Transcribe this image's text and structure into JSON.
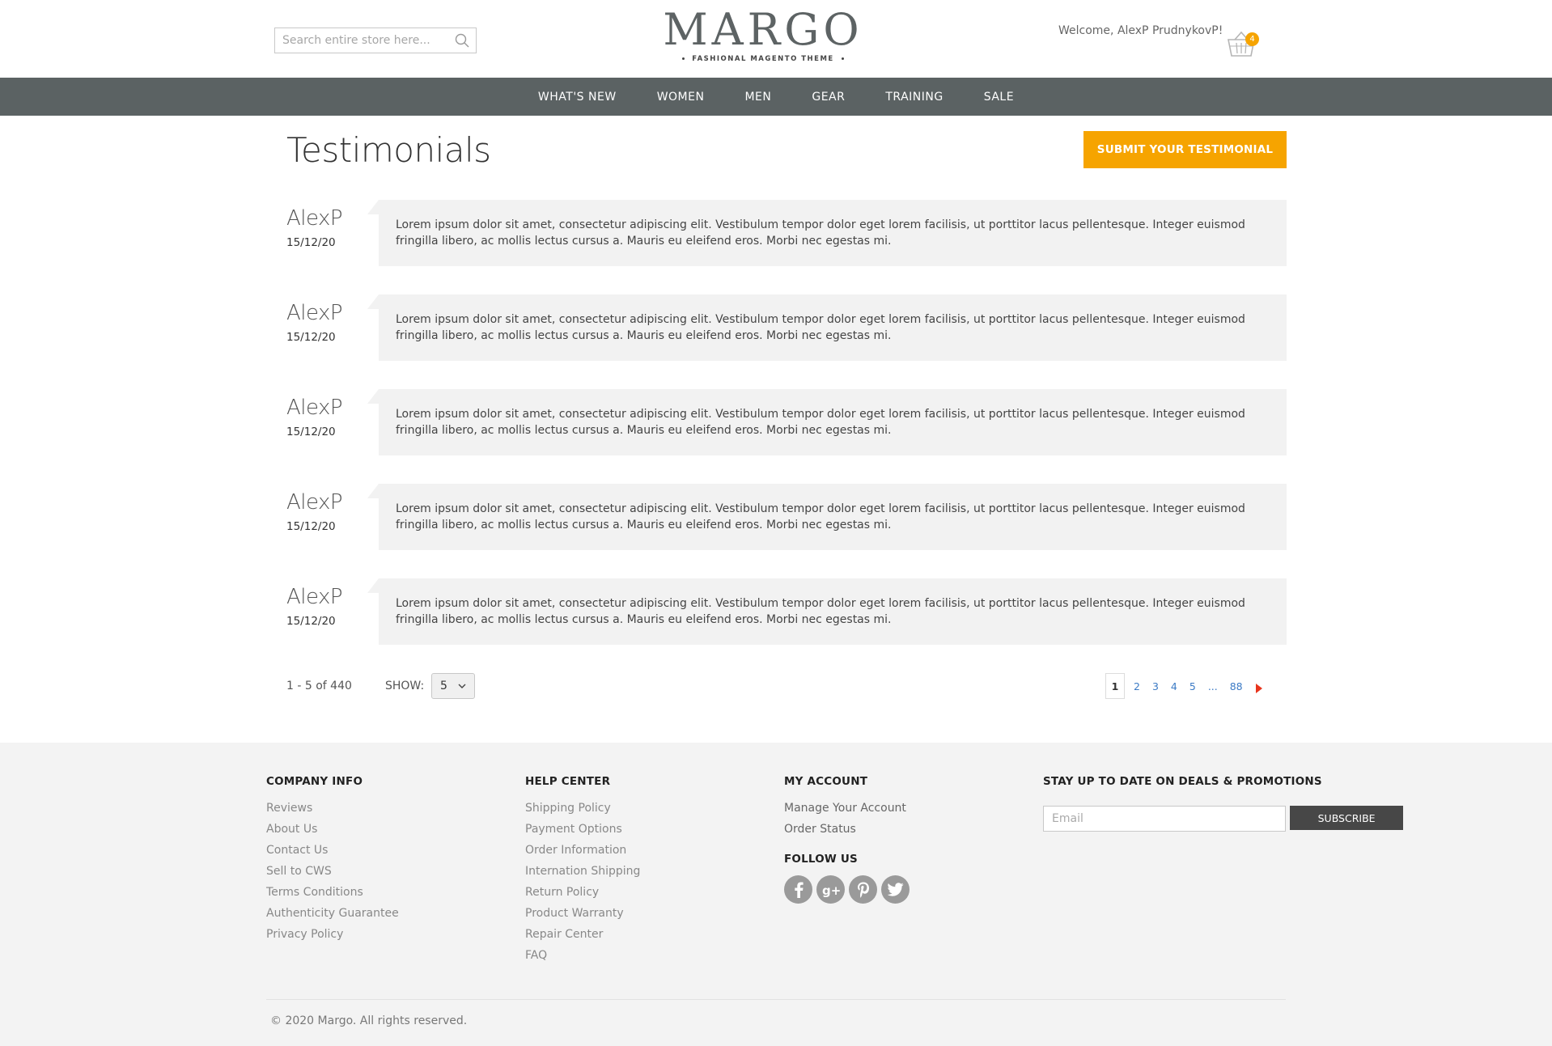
{
  "header": {
    "search_placeholder": "Search entire store here...",
    "logo_brand": "MARGO",
    "logo_tagline": "FASHIONAL MAGENTO THEME",
    "welcome": "Welcome, AlexP PrudnykovP!",
    "cart_count": "4"
  },
  "nav": {
    "items": [
      {
        "label": "WHAT'S NEW"
      },
      {
        "label": "WOMEN"
      },
      {
        "label": "MEN"
      },
      {
        "label": "GEAR"
      },
      {
        "label": "TRAINING"
      },
      {
        "label": "SALE"
      }
    ]
  },
  "main": {
    "title": "Testimonials",
    "submit_label": "SUBMIT YOUR TESTIMONIAL",
    "testimonials": [
      {
        "author": "AlexP",
        "date": "15/12/20",
        "text": "Lorem ipsum dolor sit amet, consectetur adipiscing elit. Vestibulum tempor dolor eget lorem facilisis, ut porttitor lacus pellentesque. Integer euismod fringilla libero, ac mollis lectus cursus a. Mauris eu eleifend eros. Morbi nec egestas mi."
      },
      {
        "author": "AlexP",
        "date": "15/12/20",
        "text": "Lorem ipsum dolor sit amet, consectetur adipiscing elit. Vestibulum tempor dolor eget lorem facilisis, ut porttitor lacus pellentesque. Integer euismod fringilla libero, ac mollis lectus cursus a. Mauris eu eleifend eros. Morbi nec egestas mi."
      },
      {
        "author": "AlexP",
        "date": "15/12/20",
        "text": "Lorem ipsum dolor sit amet, consectetur adipiscing elit. Vestibulum tempor dolor eget lorem facilisis, ut porttitor lacus pellentesque. Integer euismod fringilla libero, ac mollis lectus cursus a. Mauris eu eleifend eros. Morbi nec egestas mi."
      },
      {
        "author": "AlexP",
        "date": "15/12/20",
        "text": "Lorem ipsum dolor sit amet, consectetur adipiscing elit. Vestibulum tempor dolor eget lorem facilisis, ut porttitor lacus pellentesque. Integer euismod fringilla libero, ac mollis lectus cursus a. Mauris eu eleifend eros. Morbi nec egestas mi."
      },
      {
        "author": "AlexP",
        "date": "15/12/20",
        "text": "Lorem ipsum dolor sit amet, consectetur adipiscing elit. Vestibulum tempor dolor eget lorem facilisis, ut porttitor lacus pellentesque. Integer euismod fringilla libero, ac mollis lectus cursus a. Mauris eu eleifend eros. Morbi nec egestas mi."
      }
    ],
    "count_text": "1 - 5 of 440",
    "show_label": "SHOW:",
    "show_value": "5",
    "pages": [
      "1",
      "2",
      "3",
      "4",
      "5",
      "...",
      "88"
    ]
  },
  "footer": {
    "company": {
      "heading": "COMPANY INFO",
      "links": [
        "Reviews",
        "About Us",
        "Contact Us",
        "Sell to CWS",
        "Terms Conditions",
        "Authenticity Guarantee",
        "Privacy Policy"
      ]
    },
    "help": {
      "heading": "HELP CENTER",
      "links": [
        "Shipping Policy",
        "Payment Options",
        "Order Information",
        "Internation Shipping",
        "Return Policy",
        "Product Warranty",
        "Repair Center",
        "FAQ"
      ]
    },
    "account": {
      "heading": "MY ACCOUNT",
      "links": [
        "Manage Your Account",
        "Order Status"
      ],
      "follow_heading": "FOLLOW US",
      "social_icons": [
        "facebook-icon",
        "google-plus-icon",
        "pinterest-icon",
        "twitter-icon"
      ]
    },
    "newsletter": {
      "heading": "STAY UP TO DATE ON DEALS & PROMOTIONS",
      "email_placeholder": "Email",
      "subscribe_label": "SUBSCRIBE"
    },
    "copyright": "© 2020 Margo. All rights reserved."
  },
  "colors": {
    "accent": "#f6a400",
    "nav_bg": "#5b6263",
    "footer_bg": "#f3f3f3",
    "link_blue": "#3b7ac5",
    "pager_next": "#e8341c"
  }
}
